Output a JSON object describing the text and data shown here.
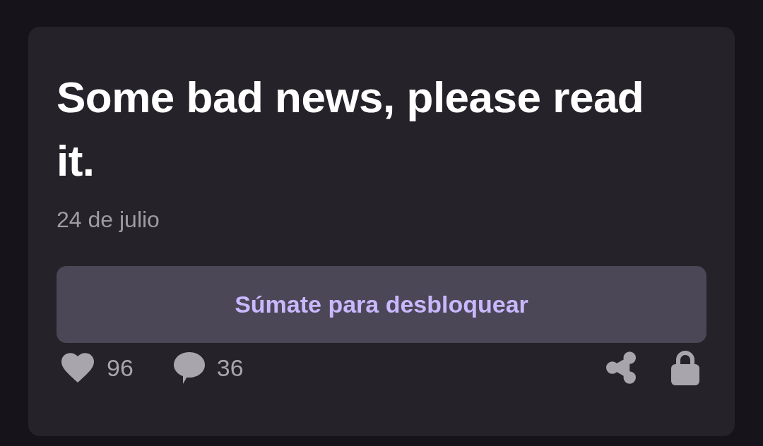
{
  "post": {
    "title": "Some bad news, please read it.",
    "date": "24 de julio",
    "unlock_button": "Súmate para desbloquear",
    "likes": "96",
    "comments": "36"
  }
}
